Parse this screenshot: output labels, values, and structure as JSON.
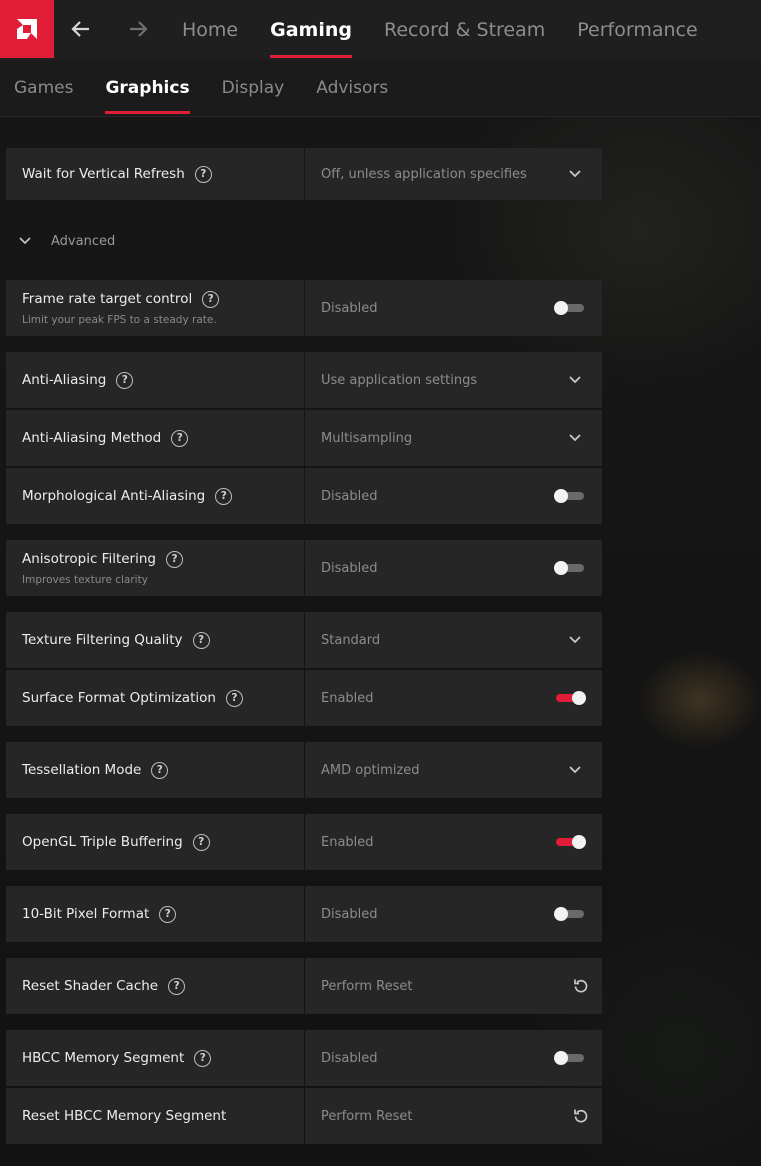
{
  "app": {
    "accent": "#e01e37"
  },
  "top_nav": {
    "items": [
      {
        "label": "Home",
        "active": false
      },
      {
        "label": "Gaming",
        "active": true
      },
      {
        "label": "Record & Stream",
        "active": false
      },
      {
        "label": "Performance",
        "active": false
      }
    ]
  },
  "sub_nav": {
    "items": [
      {
        "label": "Games",
        "active": false
      },
      {
        "label": "Graphics",
        "active": true
      },
      {
        "label": "Display",
        "active": false
      },
      {
        "label": "Advisors",
        "active": false
      }
    ]
  },
  "advanced_label": "Advanced",
  "settings": [
    {
      "label": "Wait for Vertical Refresh",
      "value": "Off, unless application specifies",
      "control": "dropdown"
    },
    {
      "label": "Frame rate target control",
      "description": "Limit your peak FPS to a steady rate.",
      "value": "Disabled",
      "control": "toggle",
      "on": false
    },
    {
      "label": "Anti-Aliasing",
      "value": "Use application settings",
      "control": "dropdown"
    },
    {
      "label": "Anti-Aliasing Method",
      "value": "Multisampling",
      "control": "dropdown"
    },
    {
      "label": "Morphological Anti-Aliasing",
      "value": "Disabled",
      "control": "toggle",
      "on": false
    },
    {
      "label": "Anisotropic Filtering",
      "description": "Improves texture clarity",
      "value": "Disabled",
      "control": "toggle",
      "on": false
    },
    {
      "label": "Texture Filtering Quality",
      "value": "Standard",
      "control": "dropdown"
    },
    {
      "label": "Surface Format Optimization",
      "value": "Enabled",
      "control": "toggle",
      "on": true
    },
    {
      "label": "Tessellation Mode",
      "value": "AMD optimized",
      "control": "dropdown"
    },
    {
      "label": "OpenGL Triple Buffering",
      "value": "Enabled",
      "control": "toggle",
      "on": true
    },
    {
      "label": "10-Bit Pixel Format",
      "value": "Disabled",
      "control": "toggle",
      "on": false
    },
    {
      "label": "Reset Shader Cache",
      "value": "Perform Reset",
      "control": "reset"
    },
    {
      "label": "HBCC Memory Segment",
      "value": "Disabled",
      "control": "toggle",
      "on": false
    },
    {
      "label": "Reset HBCC Memory Segment",
      "value": "Perform Reset",
      "control": "reset",
      "no_help": true
    }
  ]
}
